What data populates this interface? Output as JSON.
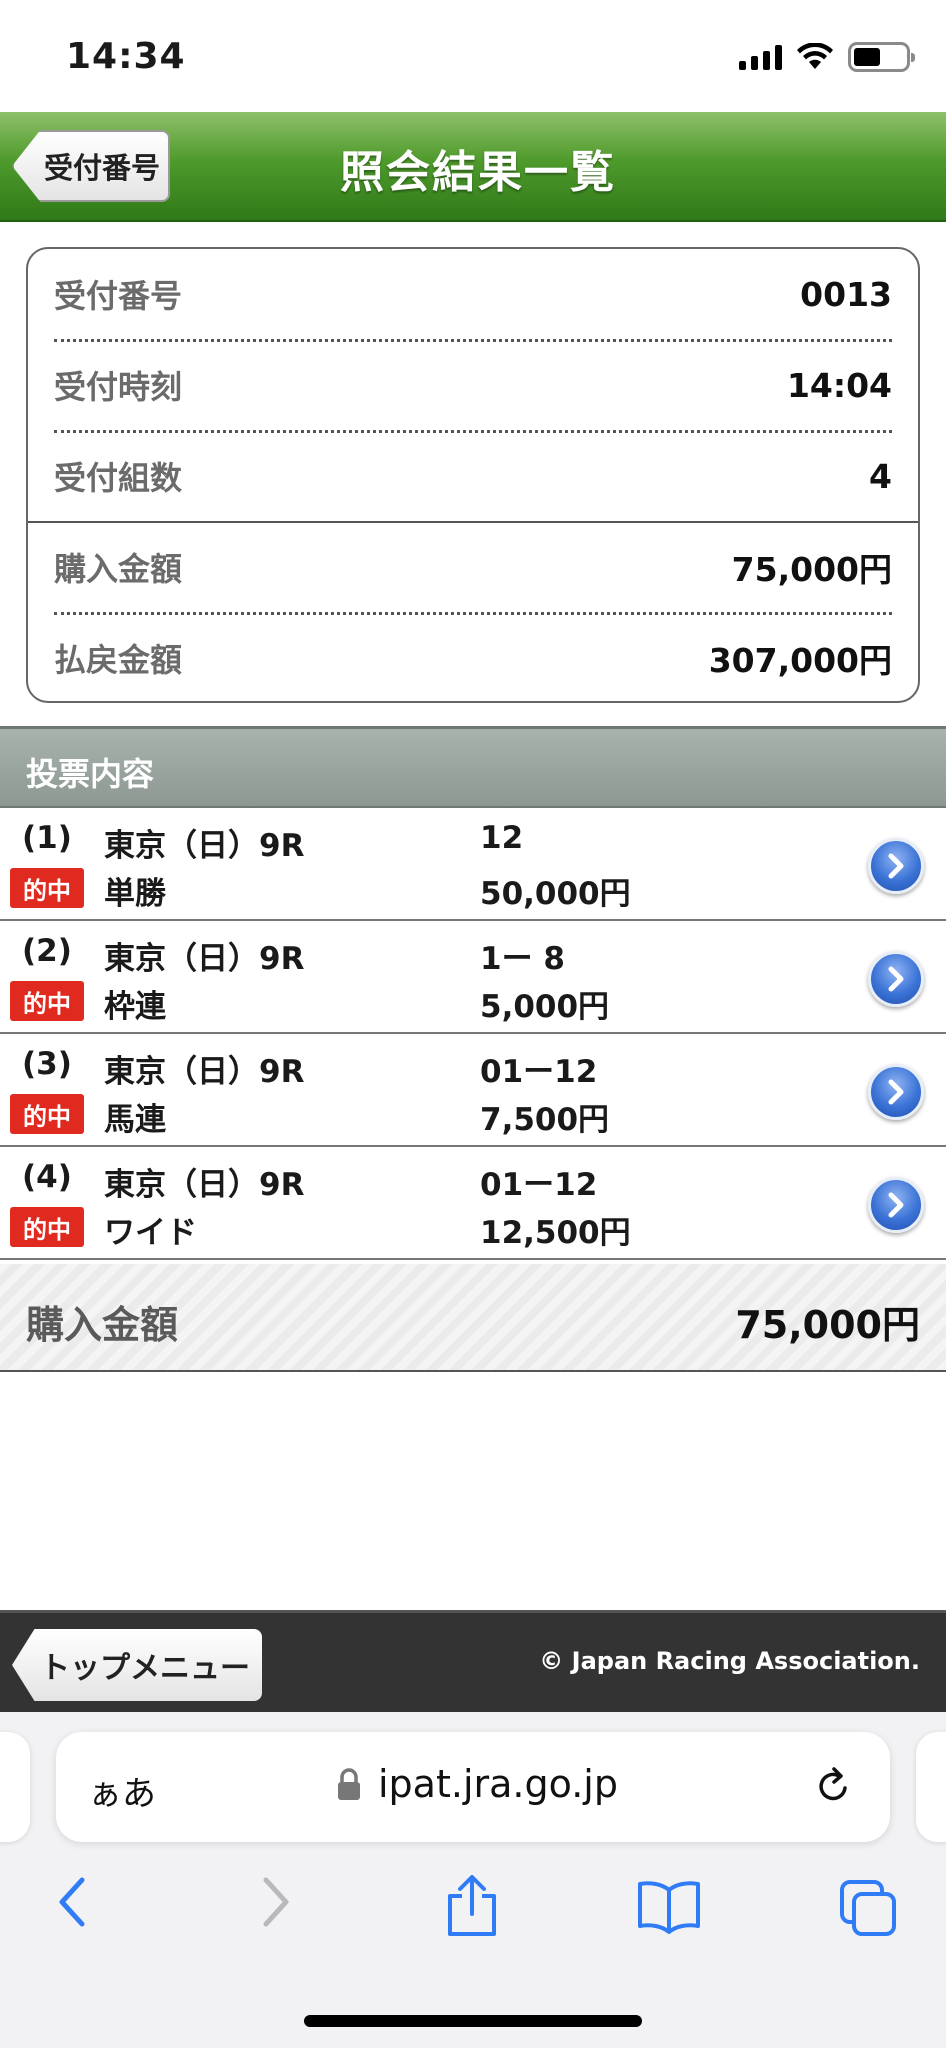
{
  "status_bar": {
    "time": "14:34"
  },
  "header": {
    "title": "照会結果一覧",
    "back_label": "受付番号"
  },
  "summary": {
    "rows": [
      {
        "label": "受付番号",
        "value": "0013"
      },
      {
        "label": "受付時刻",
        "value": "14:04"
      },
      {
        "label": "受付組数",
        "value": "4"
      },
      {
        "label": "購入金額",
        "value": "75,000円"
      },
      {
        "label": "払戻金額",
        "value": "307,000円"
      }
    ]
  },
  "section": {
    "title": "投票内容"
  },
  "tickets": [
    {
      "no": "(1)",
      "race": "東京（日）9R",
      "hit": "的中",
      "bet_type": "単勝",
      "combination": "12",
      "amount": "50,000円"
    },
    {
      "no": "(2)",
      "race": "東京（日）9R",
      "hit": "的中",
      "bet_type": "枠連",
      "combination": "1ー 8",
      "amount": "5,000円"
    },
    {
      "no": "(3)",
      "race": "東京（日）9R",
      "hit": "的中",
      "bet_type": "馬連",
      "combination": "01ー12",
      "amount": "7,500円"
    },
    {
      "no": "(4)",
      "race": "東京（日）9R",
      "hit": "的中",
      "bet_type": "ワイド",
      "combination": "01ー12",
      "amount": "12,500円"
    }
  ],
  "total": {
    "label": "購入金額",
    "value": "75,000円"
  },
  "footer": {
    "top_menu_label": "トップメニュー",
    "copyright": "© Japan Racing Association."
  },
  "browser": {
    "aa_label": "ぁあ",
    "url": "ipat.jra.go.jp"
  },
  "colors": {
    "header_green": "#4f9a2c",
    "hit_red": "#e02a1f",
    "arrow_blue": "#3b73d6",
    "footer_dark": "#333333"
  }
}
